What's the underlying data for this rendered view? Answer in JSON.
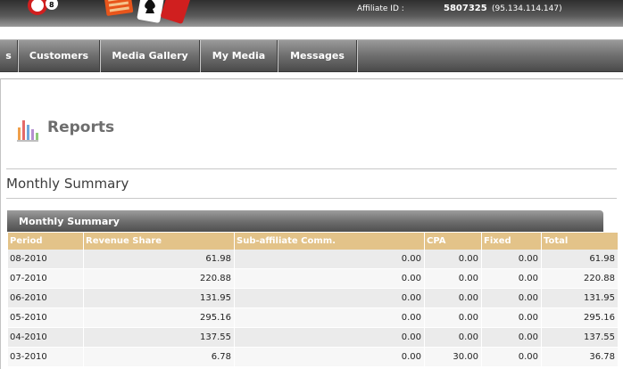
{
  "header": {
    "affiliate_label": "Affiliate ID :",
    "affiliate_id": "5807325",
    "affiliate_ip": "(95.134.114.147)"
  },
  "nav": {
    "stub": "s",
    "items": [
      "Customers",
      "Media Gallery",
      "My Media",
      "Messages"
    ]
  },
  "page": {
    "title": "Reports",
    "section_title": "Monthly Summary",
    "panel_title": "Monthly Summary"
  },
  "table": {
    "columns": [
      "Period",
      "Revenue Share",
      "Sub-affiliate Comm.",
      "CPA",
      "Fixed",
      "Total"
    ],
    "rows": [
      [
        "08-2010",
        "61.98",
        "0.00",
        "0.00",
        "0.00",
        "61.98"
      ],
      [
        "07-2010",
        "220.88",
        "0.00",
        "0.00",
        "0.00",
        "220.88"
      ],
      [
        "06-2010",
        "131.95",
        "0.00",
        "0.00",
        "0.00",
        "131.95"
      ],
      [
        "05-2010",
        "295.16",
        "0.00",
        "0.00",
        "0.00",
        "295.16"
      ],
      [
        "04-2010",
        "137.55",
        "0.00",
        "0.00",
        "0.00",
        "137.55"
      ],
      [
        "03-2010",
        "6.78",
        "0.00",
        "30.00",
        "0.00",
        "36.78"
      ]
    ]
  },
  "colors": {
    "header_dark": "#2f2f2f",
    "table_header": "#e3c389",
    "row_odd": "#ebebeb",
    "row_even": "#f7f7f7"
  },
  "icons": {
    "logo": "casino-logo-icon",
    "reports": "bar-chart-icon"
  }
}
